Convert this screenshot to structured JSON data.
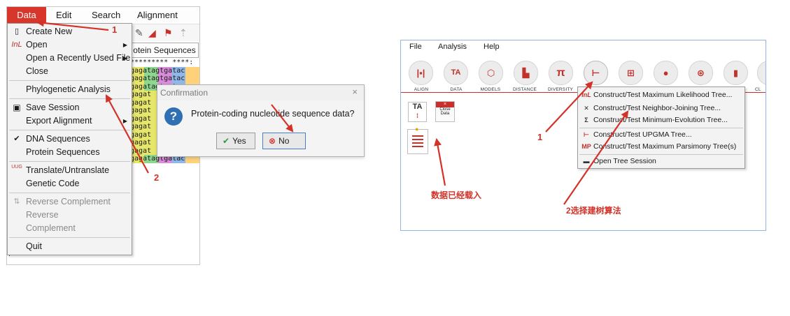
{
  "left_window": {
    "menus": [
      "Data",
      "Edit",
      "Search",
      "Alignment"
    ],
    "tab_label": "otein Sequences",
    "sequence_rows": [
      "*********  ****:",
      "gagatagtgatac",
      "gagatagtgatac",
      "gagatagtgatac",
      "gagat",
      "gagat",
      "gagat",
      "gagat",
      "gagat",
      "gagat",
      "gagat",
      "gagat",
      "gagatagtgatac"
    ]
  },
  "data_menu": {
    "items": [
      {
        "label": "Create New",
        "icon": "new-file-icon"
      },
      {
        "label": "Open",
        "icon": "InL"
      },
      {
        "label": "Open a Recently Used File"
      },
      {
        "label": "Close"
      },
      {
        "label": "Phylogenetic Analysis"
      },
      {
        "label": "Save Session",
        "icon": "save-icon"
      },
      {
        "label": "Export Alignment"
      },
      {
        "label": "DNA Sequences",
        "icon": "✔"
      },
      {
        "label": "Protein Sequences"
      },
      {
        "label": "Translate/Untranslate",
        "icon": "UUG"
      },
      {
        "label": "Genetic Code"
      },
      {
        "label": "Reverse Complement"
      },
      {
        "label": "Reverse"
      },
      {
        "label": "Complement"
      },
      {
        "label": "Quit"
      }
    ]
  },
  "dialog": {
    "title": "Confirmation",
    "close": "×",
    "message": "Protein-coding nucleotide sequence data?",
    "yes": "Yes",
    "no": "No"
  },
  "right_window": {
    "menus": [
      "File",
      "Analysis",
      "Help"
    ],
    "toolbar": [
      {
        "label": "ALIGN",
        "icon": "align-icon"
      },
      {
        "label": "DATA",
        "icon": "TA"
      },
      {
        "label": "MODELS",
        "icon": "models-icon"
      },
      {
        "label": "DISTANCE",
        "icon": "distance-icon"
      },
      {
        "label": "DIVERSITY",
        "icon": "π"
      },
      {
        "label": "",
        "icon": "phylogeny-icon"
      },
      {
        "label": "",
        "icon": "user-tree-icon"
      },
      {
        "label": "",
        "icon": "ancestors-icon"
      },
      {
        "label": "",
        "icon": "selection-icon"
      },
      {
        "label": "",
        "icon": "rates-icon"
      },
      {
        "label": "CL",
        "icon": "clocks-icon"
      }
    ],
    "close_data": "Close Data",
    "ta_glyph": "TA",
    "note_loaded": "数据已经载入",
    "note_algo": "2选择建树算法"
  },
  "phylogeny_menu": {
    "items": [
      {
        "icon": "InL",
        "label": "Construct/Test Maximum Likelihood Tree..."
      },
      {
        "icon": "NJ",
        "label": "Construct/Test Neighbor-Joining Tree..."
      },
      {
        "icon": "ME",
        "label": "Construct/Test Minimum-Evolution Tree..."
      },
      {
        "icon": "UP",
        "label": "Construct/Test UPGMA Tree..."
      },
      {
        "icon": "MP",
        "label": "Construct/Test Maximum Parsimony Tree(s)"
      },
      {
        "icon": "folder-icon",
        "label": "Open Tree Session"
      }
    ]
  },
  "annotations": {
    "left_1": "1",
    "left_2": "2",
    "right_1": "1"
  },
  "colors": {
    "accent_red": "#d23228",
    "dialog_blue": "#2f6fb3",
    "mega_red": "#c0332b"
  }
}
